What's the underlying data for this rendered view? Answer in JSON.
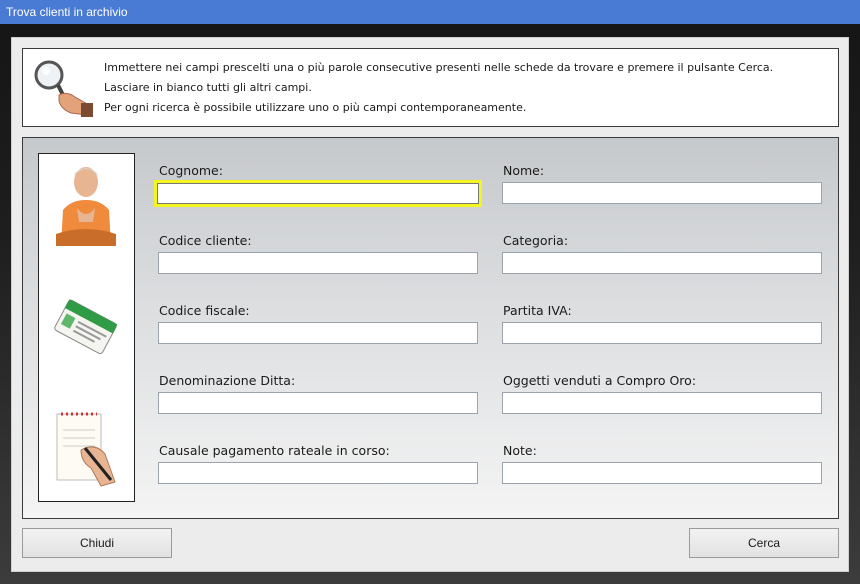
{
  "window": {
    "title": "Trova clienti in archivio"
  },
  "instructions": {
    "icon": "magnifier-in-hand-icon",
    "lines": [
      "Immettere nei campi prescelti una o più parole consecutive presenti nelle schede da trovare e premere il pulsante Cerca.",
      "Lasciare in bianco tutti gli altri campi.",
      "Per ogni ricerca è possibile utilizzare uno o più campi contemporaneamente."
    ]
  },
  "side_images": [
    "person-portrait-icon",
    "id-card-icon",
    "notepad-writing-icon"
  ],
  "fields": {
    "cognome": {
      "label": "Cognome:",
      "value": ""
    },
    "nome": {
      "label": "Nome:",
      "value": ""
    },
    "codice_cliente": {
      "label": "Codice cliente:",
      "value": ""
    },
    "categoria": {
      "label": "Categoria:",
      "value": ""
    },
    "codice_fiscale": {
      "label": "Codice fiscale:",
      "value": ""
    },
    "partita_iva": {
      "label": "Partita IVA:",
      "value": ""
    },
    "denominazione": {
      "label": "Denominazione Ditta:",
      "value": ""
    },
    "oggetti": {
      "label": "Oggetti venduti a Compro Oro:",
      "value": ""
    },
    "causale": {
      "label": "Causale pagamento rateale in corso:",
      "value": ""
    },
    "note": {
      "label": "Note:",
      "value": ""
    }
  },
  "buttons": {
    "close": "Chiudi",
    "search": "Cerca"
  },
  "colors": {
    "titlebar": "#4a7bd4",
    "focus_border": "#f4f41f"
  }
}
